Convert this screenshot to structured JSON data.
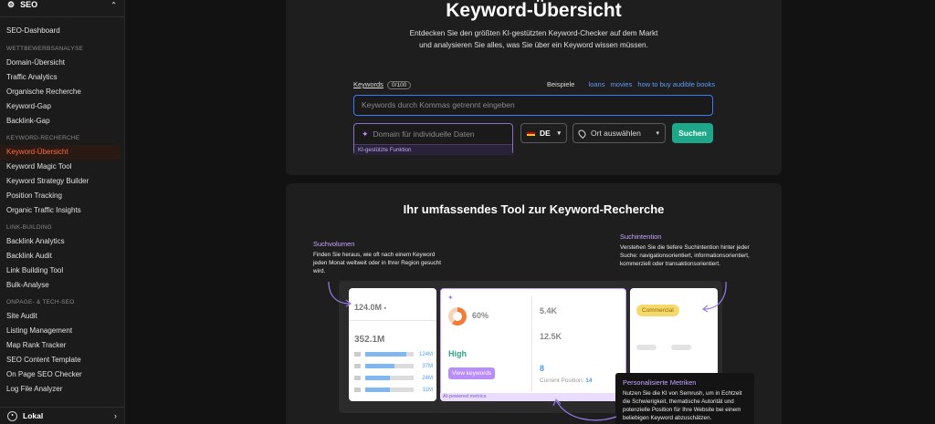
{
  "sidebar": {
    "top": {
      "label": "SEO"
    },
    "dashboard": "SEO-Dashboard",
    "sections": [
      {
        "title": "WETTBEWERBSANALYSE",
        "items": [
          "Domain-Übersicht",
          "Traffic Analytics",
          "Organische Recherche",
          "Keyword-Gap",
          "Backlink-Gap"
        ]
      },
      {
        "title": "KEYWORD-RECHERCHE",
        "items": [
          "Keyword-Übersicht",
          "Keyword Magic Tool",
          "Keyword Strategy Builder",
          "Position Tracking",
          "Organic Traffic Insights"
        ]
      },
      {
        "title": "LINK-BUILDING",
        "items": [
          "Backlink Analytics",
          "Backlink Audit",
          "Link Building Tool",
          "Bulk-Analyse"
        ]
      },
      {
        "title": "ONPAGE- & TECH-SEO",
        "items": [
          "Site Audit",
          "Listing Management",
          "Map Rank Tracker",
          "SEO Content Template",
          "On Page SEO Checker",
          "Log File Analyzer"
        ]
      }
    ],
    "active_item": "Keyword-Übersicht",
    "bottom": {
      "label": "Lokal"
    }
  },
  "hero": {
    "title": "Keyword-Übersicht",
    "subtitle": "Entdecken Sie den größten KI-gestützten Keyword-Checker auf dem Markt und analysieren Sie alles, was Sie über ein Keyword wissen müssen.",
    "keywords_label": "Keywords",
    "keywords_count": "0/100",
    "examples_label": "Beispiele",
    "examples": [
      "loans",
      "movies",
      "how to buy audible books"
    ],
    "keyword_placeholder": "Keywords durch Kommas getrennt eingeben",
    "domain_placeholder": "Domain für individuelle Daten",
    "ai_label": "KI-gestützte Funktion",
    "language": "DE",
    "location_placeholder": "Ort auswählen",
    "search_label": "Suchen"
  },
  "features": {
    "title": "Ihr umfassendes Tool zur Keyword-Recherche",
    "tip_volume": {
      "title": "Suchvolumen",
      "text": "Finden Sie heraus, wie oft nach einem Keyword jeden Monat weltweit oder in Ihrer Region gesucht wird."
    },
    "tip_intent": {
      "title": "Suchintention",
      "text": "Verstehen Sie die tiefere Suchintention hinter jeder Suche: navigationsorientiert, informationsorientiert, kommerziell oder transaktionsorientiert."
    },
    "tip_metrics": {
      "title": "Personalisierte Metriken",
      "text": "Nutzen Sie die KI von Semrush, um in Echtzeit die Schwierigkeit, thematische Autorität und potenzielle Position für Ihre Website bei einem beliebigen Keyword abzuschätzen."
    },
    "volume_global": "124.0M",
    "volume_local": "352.1M",
    "country_volumes": [
      {
        "value": "124M",
        "fill": 0.85
      },
      {
        "value": "37M",
        "fill": 0.6
      },
      {
        "value": "24M",
        "fill": 0.5
      },
      {
        "value": "11M",
        "fill": 0.5
      }
    ],
    "difficulty_pct": "60%",
    "difficulty_level": "High",
    "view_keywords": "View keywords",
    "metric_1": "5.4K",
    "metric_2": "12.5K",
    "metric_3": "8",
    "current_position_label": "Current Position:",
    "current_position": "14",
    "ai_metrics_label": "AI-powered metrics",
    "intent_badge": "Commercial"
  }
}
